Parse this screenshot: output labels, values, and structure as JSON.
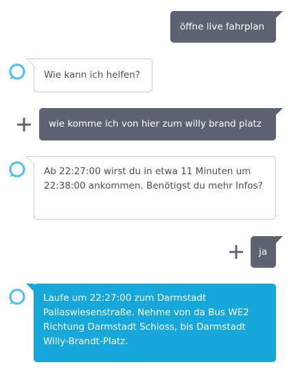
{
  "conversation": {
    "messages": [
      {
        "sender": "user",
        "text": "öffne live fahrplan"
      },
      {
        "sender": "assistant",
        "text": "Wie kann ich helfen?"
      },
      {
        "sender": "user",
        "text": "wie komme ich von hier zum willy brand platz"
      },
      {
        "sender": "assistant",
        "text": "Ab 22:27:00 wirst du in etwa 11 Minuten um 22:38:00 ankommen. Benötigst du mehr Infos?"
      },
      {
        "sender": "user",
        "text": "ja"
      },
      {
        "sender": "assistant",
        "text": "Laufe um 22:27:00 zum Darmstadt Pallaswiesenstraße. Nehme von da Bus WE2 Richtung Darmstadt Schloss, bis Darmstadt Willy-Brandt-Platz."
      }
    ]
  },
  "icons": {
    "assistant_avatar": "alexa-ring-icon",
    "user_action": "plus-icon"
  },
  "colors": {
    "user_bubble": "#5b6470",
    "assistant_bubble_border": "#c5cad0",
    "assistant_active_bubble": "#17a8db",
    "alexa_ring": "#4fc3ee"
  }
}
